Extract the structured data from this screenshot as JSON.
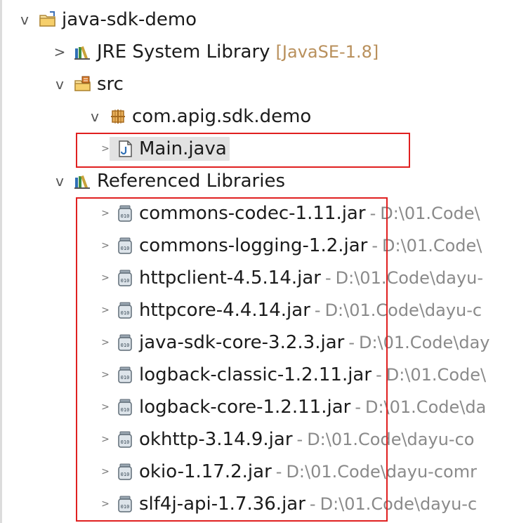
{
  "tree": {
    "project": {
      "label": "java-sdk-demo",
      "expanded_glyph": "v",
      "icon": "project-folder-icon"
    },
    "jre": {
      "label": "JRE System Library",
      "decoration": "[JavaSE-1.8]",
      "collapsed_glyph": ">",
      "icon": "library-icon"
    },
    "src": {
      "label": "src",
      "expanded_glyph": "v",
      "icon": "source-folder-icon"
    },
    "package": {
      "label": "com.apig.sdk.demo",
      "expanded_glyph": "v",
      "icon": "package-icon"
    },
    "main_file": {
      "label": "Main.java",
      "collapsed_glyph": ">",
      "icon": "java-file-icon"
    },
    "ref_libs": {
      "label": "Referenced Libraries",
      "expanded_glyph": "v",
      "icon": "library-icon"
    },
    "jar_separator": "-",
    "jars": [
      {
        "label": "commons-codec-1.11.jar",
        "path": "D:\\01.Code\\"
      },
      {
        "label": "commons-logging-1.2.jar",
        "path": "D:\\01.Code\\"
      },
      {
        "label": "httpclient-4.5.14.jar",
        "path": "D:\\01.Code\\dayu-"
      },
      {
        "label": "httpcore-4.4.14.jar",
        "path": "D:\\01.Code\\dayu-c"
      },
      {
        "label": "java-sdk-core-3.2.3.jar",
        "path": "D:\\01.Code\\day"
      },
      {
        "label": "logback-classic-1.2.11.jar",
        "path": "D:\\01.Code\\"
      },
      {
        "label": "logback-core-1.2.11.jar",
        "path": "D:\\01.Code\\da"
      },
      {
        "label": "okhttp-3.14.9.jar",
        "path": "D:\\01.Code\\dayu-co"
      },
      {
        "label": "okio-1.17.2.jar",
        "path": "D:\\01.Code\\dayu-comr"
      },
      {
        "label": "slf4j-api-1.7.36.jar",
        "path": "D:\\01.Code\\dayu-c"
      }
    ],
    "jar_collapsed_glyph": ">",
    "jar_icon": "jar-icon"
  },
  "colors": {
    "highlight": "#e02020",
    "decoration_gold": "#b9905c",
    "decoration_grey": "#8a8a8a",
    "selection": "#e2e2e2"
  }
}
